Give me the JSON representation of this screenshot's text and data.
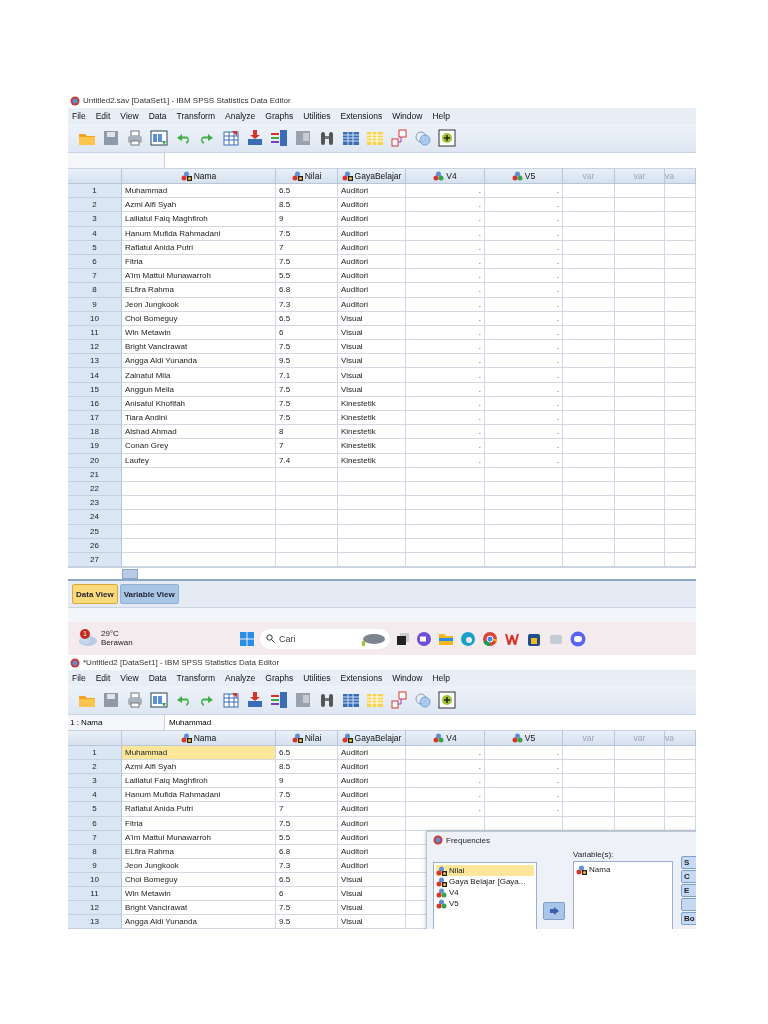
{
  "windows": [
    {
      "title": "Untitled2.sav [DataSet1] - IBM SPSS Statistics Data Editor",
      "menu": [
        "File",
        "Edit",
        "View",
        "Data",
        "Transform",
        "Analyze",
        "Graphs",
        "Utilities",
        "Extensions",
        "Window",
        "Help"
      ],
      "columns": [
        {
          "label": "Nama",
          "kind": "nominal"
        },
        {
          "label": "Nilai",
          "kind": "nominal"
        },
        {
          "label": "GayaBelajar",
          "kind": "nominal"
        },
        {
          "label": "V4",
          "kind": "numeric"
        },
        {
          "label": "V5",
          "kind": "numeric"
        },
        {
          "label": "var",
          "kind": "empty"
        },
        {
          "label": "var",
          "kind": "empty"
        },
        {
          "label": "va",
          "kind": "empty"
        }
      ],
      "rows": [
        {
          "num": "1",
          "selected": false,
          "cells": [
            "Muhammad",
            "6.5",
            "Auditori",
            ".",
            "."
          ]
        },
        {
          "num": "2",
          "selected": false,
          "cells": [
            "Azmi Alfi Syah",
            "8.5",
            "Auditori",
            ".",
            "."
          ]
        },
        {
          "num": "3",
          "selected": false,
          "cells": [
            "Lailiatul Faiq Maghfiroh",
            "9",
            "Auditori",
            ".",
            "."
          ]
        },
        {
          "num": "4",
          "selected": false,
          "cells": [
            "Hanum Mufida Rahmadani",
            "7.5",
            "Auditori",
            ".",
            "."
          ]
        },
        {
          "num": "5",
          "selected": false,
          "cells": [
            "Rafiatul Anida Putri",
            "7",
            "Auditori",
            ".",
            "."
          ]
        },
        {
          "num": "6",
          "selected": false,
          "cells": [
            "Fitria",
            "7.5",
            "Auditori",
            ".",
            "."
          ]
        },
        {
          "num": "7",
          "selected": false,
          "cells": [
            "A'im Mattul Munawarroh",
            "5.5",
            "Auditori",
            ".",
            "."
          ]
        },
        {
          "num": "8",
          "selected": false,
          "cells": [
            "ELfira Rahma",
            "6.8",
            "Auditori",
            ".",
            "."
          ]
        },
        {
          "num": "9",
          "selected": false,
          "cells": [
            "Jeon Jungkook",
            "7.3",
            "Auditori",
            ".",
            "."
          ]
        },
        {
          "num": "10",
          "selected": false,
          "cells": [
            "Choi Bomeguy",
            "6.5",
            "Visual",
            ".",
            "."
          ]
        },
        {
          "num": "11",
          "selected": false,
          "cells": [
            "Win Metawin",
            "6",
            "Visual",
            ".",
            "."
          ]
        },
        {
          "num": "12",
          "selected": false,
          "cells": [
            "Bright Vancirawat",
            "7.5",
            "Visual",
            ".",
            "."
          ]
        },
        {
          "num": "13",
          "selected": false,
          "cells": [
            "Angga Aldi Yunanda",
            "9.5",
            "Visual",
            ".",
            "."
          ]
        },
        {
          "num": "14",
          "selected": false,
          "cells": [
            "Zainatul Mila",
            "7.1",
            "Visual",
            ".",
            "."
          ]
        },
        {
          "num": "15",
          "selected": false,
          "cells": [
            "Anggun Meila",
            "7.5",
            "Visual",
            ".",
            "."
          ]
        },
        {
          "num": "16",
          "selected": false,
          "cells": [
            "Anisatul Khofifah",
            "7.5",
            "Kinestetik",
            ".",
            "."
          ]
        },
        {
          "num": "17",
          "selected": false,
          "cells": [
            "Tiara Andini",
            "7.5",
            "Kinestetik",
            ".",
            "."
          ]
        },
        {
          "num": "18",
          "selected": false,
          "cells": [
            "Alshad Ahmad",
            "8",
            "Kinestetik",
            ".",
            "."
          ]
        },
        {
          "num": "19",
          "selected": false,
          "cells": [
            "Conan Grey",
            "7",
            "Kinestetik",
            ".",
            "."
          ]
        },
        {
          "num": "20",
          "selected": false,
          "cells": [
            "Laufey",
            "7.4",
            "Kinestetik",
            ".",
            "."
          ]
        },
        {
          "num": "21",
          "selected": false
        },
        {
          "num": "22",
          "selected": false
        },
        {
          "num": "23",
          "selected": false
        },
        {
          "num": "24",
          "selected": false
        },
        {
          "num": "25",
          "selected": false
        },
        {
          "num": "26",
          "selected": false
        },
        {
          "num": "27",
          "selected": false
        }
      ],
      "tabs": [
        {
          "label": "Data View",
          "selected": true
        },
        {
          "label": "Variable View",
          "selected": false
        }
      ],
      "taskbar": {
        "badge": "1",
        "temperature": "29°C",
        "weather": "Berawan",
        "search_placeholder": "Cari"
      }
    },
    {
      "title": "*Untitled2 [DataSet1] - IBM SPSS Statistics Data Editor",
      "menu": [
        "File",
        "Edit",
        "View",
        "Data",
        "Transform",
        "Analyze",
        "Graphs",
        "Utilities",
        "Extensions",
        "Window",
        "Help"
      ],
      "cell_editor": {
        "ref": "1 : Nama",
        "value": "Muhammad"
      },
      "columns": [
        {
          "label": "Nama",
          "kind": "nominal"
        },
        {
          "label": "Nilai",
          "kind": "nominal"
        },
        {
          "label": "GayaBelajar",
          "kind": "nominal"
        },
        {
          "label": "V4",
          "kind": "numeric"
        },
        {
          "label": "V5",
          "kind": "numeric"
        },
        {
          "label": "var",
          "kind": "empty"
        },
        {
          "label": "var",
          "kind": "empty"
        },
        {
          "label": "va",
          "kind": "empty"
        }
      ],
      "rows": [
        {
          "num": "1",
          "selected": true,
          "cells": [
            "Muhammad",
            "6.5",
            "Auditori",
            ".",
            "."
          ]
        },
        {
          "num": "2",
          "selected": false,
          "cells": [
            "Azmi Alfi Syah",
            "8.5",
            "Auditori",
            ".",
            "."
          ]
        },
        {
          "num": "3",
          "selected": false,
          "cells": [
            "Lailiatul Faiq Maghfiroh",
            "9",
            "Auditori",
            ".",
            "."
          ]
        },
        {
          "num": "4",
          "selected": false,
          "cells": [
            "Hanum Mufida Rahmadani",
            "7.5",
            "Auditori",
            ".",
            "."
          ]
        },
        {
          "num": "5",
          "selected": false,
          "cells": [
            "Rafiatul Anida Putri",
            "7",
            "Auditori",
            ".",
            "."
          ]
        },
        {
          "num": "6",
          "selected": false,
          "cells": [
            "Fitria",
            "7.5",
            "Auditori"
          ]
        },
        {
          "num": "7",
          "selected": false,
          "cells": [
            "A'im Mattul Munawarroh",
            "5.5",
            "Auditori"
          ]
        },
        {
          "num": "8",
          "selected": false,
          "cells": [
            "ELfira Rahma",
            "6.8",
            "Auditori"
          ]
        },
        {
          "num": "9",
          "selected": false,
          "cells": [
            "Jeon Jungkook",
            "7.3",
            "Auditori"
          ]
        },
        {
          "num": "10",
          "selected": false,
          "cells": [
            "Choi Bomeguy",
            "6.5",
            "Visual"
          ]
        },
        {
          "num": "11",
          "selected": false,
          "cells": [
            "Win Metawin",
            "6",
            "Visual"
          ]
        },
        {
          "num": "12",
          "selected": false,
          "cells": [
            "Bright Vancirawat",
            "7.5",
            "Visual"
          ]
        },
        {
          "num": "13",
          "selected": false,
          "cells": [
            "Angga Aldi Yunanda",
            "9.5",
            "Visual"
          ]
        }
      ],
      "dialog": {
        "title": "Frequencies",
        "source": [
          {
            "label": "Nilai",
            "kind": "nominal",
            "selected": true
          },
          {
            "label": "Gaya Belajar [Gaya...",
            "kind": "nominal",
            "selected": false
          },
          {
            "label": "V4",
            "kind": "numeric",
            "selected": false
          },
          {
            "label": "V5",
            "kind": "numeric",
            "selected": false
          }
        ],
        "target_label": "Variable(s):",
        "target": [
          {
            "label": "Nama",
            "kind": "nominal"
          }
        ],
        "side_buttons": [
          {
            "label": "S"
          },
          {
            "label": "C"
          },
          {
            "label": "E"
          },
          {
            "blank": true
          },
          {
            "label": "Bo"
          }
        ]
      }
    }
  ]
}
